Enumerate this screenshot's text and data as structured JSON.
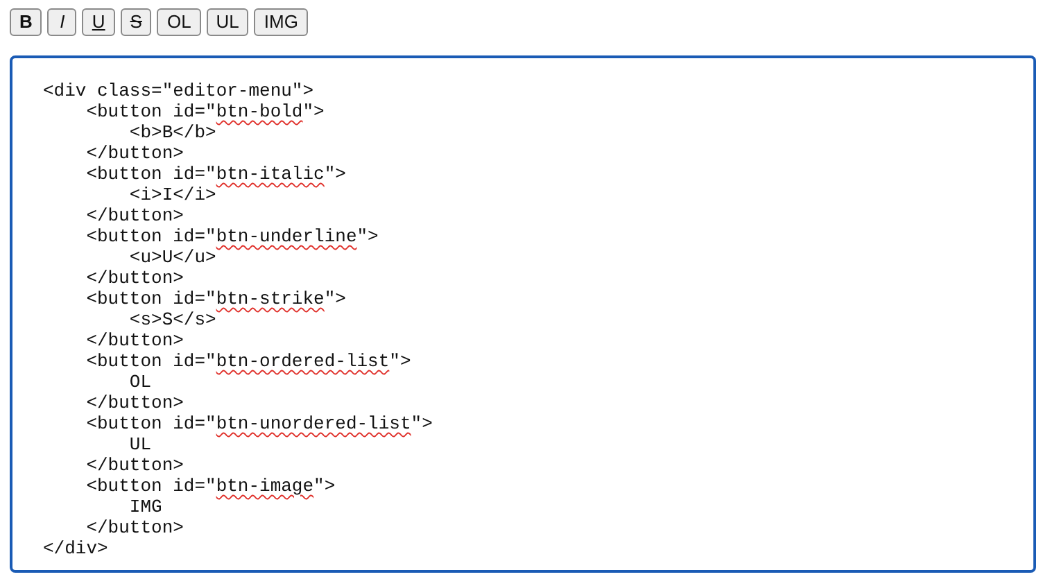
{
  "toolbar": [
    {
      "label": "B",
      "kind": "bold"
    },
    {
      "label": "I",
      "kind": "italic"
    },
    {
      "label": "U",
      "kind": "underline"
    },
    {
      "label": "S",
      "kind": "strike"
    },
    {
      "label": "OL",
      "kind": "plain"
    },
    {
      "label": "UL",
      "kind": "plain"
    },
    {
      "label": "IMG",
      "kind": "plain"
    }
  ],
  "editor": {
    "lines": [
      [
        {
          "text": "<div class=\"editor-menu\">"
        }
      ],
      [
        {
          "text": "    <button id=\""
        },
        {
          "text": "btn-bold",
          "misspelled": true
        },
        {
          "text": "\">"
        }
      ],
      [
        {
          "text": "        <b>B</b>"
        }
      ],
      [
        {
          "text": "    </button>"
        }
      ],
      [
        {
          "text": "    <button id=\""
        },
        {
          "text": "btn-italic",
          "misspelled": true
        },
        {
          "text": "\">"
        }
      ],
      [
        {
          "text": "        <i>I</i>"
        }
      ],
      [
        {
          "text": "    </button>"
        }
      ],
      [
        {
          "text": "    <button id=\""
        },
        {
          "text": "btn-underline",
          "misspelled": true
        },
        {
          "text": "\">"
        }
      ],
      [
        {
          "text": "        <u>U</u>"
        }
      ],
      [
        {
          "text": "    </button>"
        }
      ],
      [
        {
          "text": "    <button id=\""
        },
        {
          "text": "btn-strike",
          "misspelled": true
        },
        {
          "text": "\">"
        }
      ],
      [
        {
          "text": "        <s>S</s>"
        }
      ],
      [
        {
          "text": "    </button>"
        }
      ],
      [
        {
          "text": "    <button id=\""
        },
        {
          "text": "btn-ordered-list",
          "misspelled": true
        },
        {
          "text": "\">"
        }
      ],
      [
        {
          "text": "        OL"
        }
      ],
      [
        {
          "text": "    </button>"
        }
      ],
      [
        {
          "text": "    <button id=\""
        },
        {
          "text": "btn-unordered-list",
          "misspelled": true
        },
        {
          "text": "\">"
        }
      ],
      [
        {
          "text": "        UL"
        }
      ],
      [
        {
          "text": "    </button>"
        }
      ],
      [
        {
          "text": "    <button id=\""
        },
        {
          "text": "btn-image",
          "misspelled": true
        },
        {
          "text": "\">"
        }
      ],
      [
        {
          "text": "        IMG"
        }
      ],
      [
        {
          "text": "    </button>"
        }
      ],
      [
        {
          "text": "</div>"
        }
      ]
    ]
  }
}
